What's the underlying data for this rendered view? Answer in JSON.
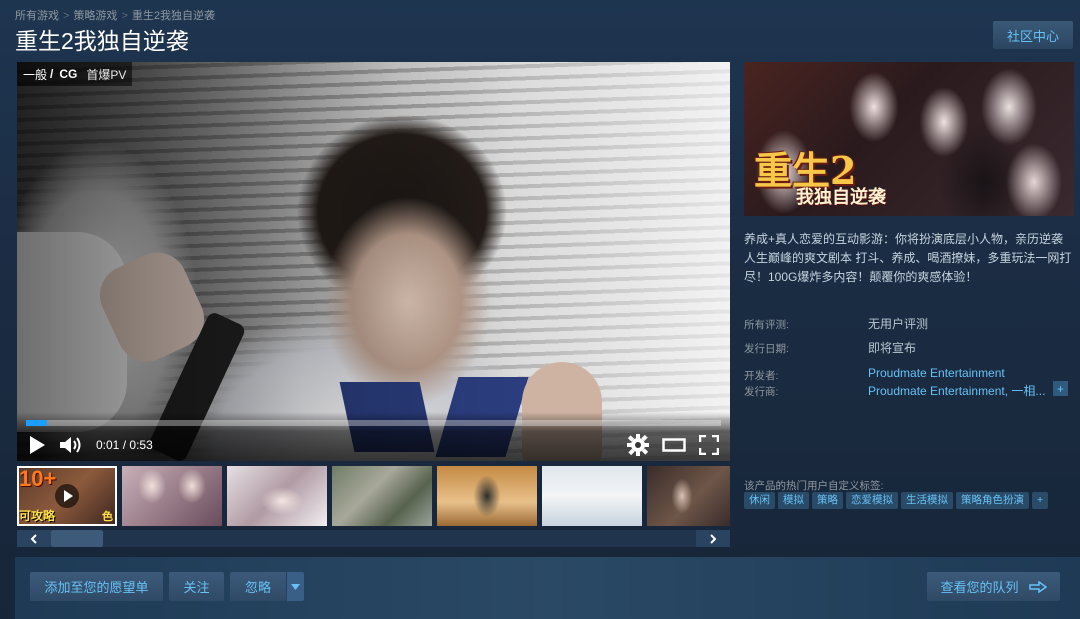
{
  "breadcrumb": {
    "items": [
      "所有游戏",
      "策略游戏",
      "重生2我独自逆袭"
    ],
    "sep": ">"
  },
  "app": {
    "title": "重生2我独自逆袭"
  },
  "header": {
    "community_hub": "社区中心"
  },
  "player": {
    "category_prefix": "一般",
    "category_sep": "/",
    "category": "CG",
    "video_name": "首爆PV",
    "current_time": "0:01",
    "sep": "/",
    "duration": "0:53",
    "progress_fraction": 0.03,
    "accent": "#1a9fff"
  },
  "thumbnails": {
    "items": [
      {
        "type": "video",
        "overlay_top": "10+",
        "overlay_bottom": "可攻略",
        "overlay_right": "色"
      },
      {
        "type": "screenshot"
      },
      {
        "type": "screenshot"
      },
      {
        "type": "screenshot"
      },
      {
        "type": "screenshot"
      },
      {
        "type": "screenshot"
      },
      {
        "type": "screenshot"
      }
    ]
  },
  "capsule": {
    "title": "重生2",
    "subtitle": "我独自逆袭"
  },
  "description": "养成+真人恋爱的互动影游：你将扮演底层小人物，亲历逆袭人生巅峰的爽文剧本 打斗、养成、喝酒撩妹，多重玩法一网打尽！100G爆炸多内容！颠覆你的爽感体验！",
  "details": {
    "reviews_label": "所有评测:",
    "reviews_value": "无用户评测",
    "release_label": "发行日期:",
    "release_value": "即将宣布",
    "developer_label": "开发者:",
    "developer_value": "Proudmate Entertainment",
    "publisher_label": "发行商:",
    "publisher_value": "Proudmate Entertainment, 一相...",
    "more": "+"
  },
  "tags": {
    "label": "该产品的热门用户自定义标签:",
    "items": [
      "休闲",
      "模拟",
      "策略",
      "恋爱模拟",
      "生活模拟",
      "策略角色扮演",
      "+"
    ]
  },
  "actions": {
    "wishlist": "添加至您的愿望单",
    "follow": "关注",
    "ignore": "忽略",
    "queue": "查看您的队列"
  },
  "colors": {
    "link": "#67c1f5",
    "bg": "#1b2838"
  }
}
